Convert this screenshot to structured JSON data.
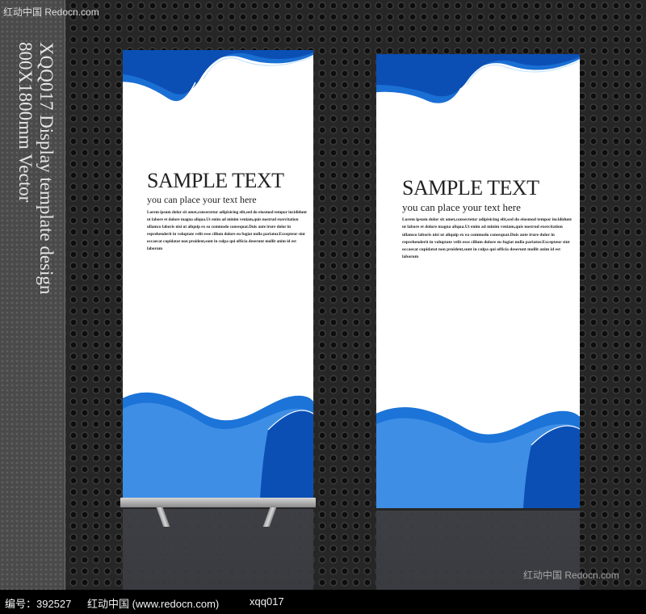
{
  "watermark_top": "红动中国 Redocn.com",
  "side_text": {
    "line1": "XQQ017 Display template design",
    "line2": "800X1800mm Vector"
  },
  "banners": [
    {
      "title": "SAMPLE TEXT",
      "subtitle": "you can place your text here",
      "lorem": "Lorem ipsum dolor sit amet,consectetur adipisicing elit,sed do eiusmod tempor incididunt ut labore et dolore magna aliqua.Ut enim ad minim veniam,quis nostrud exercitation ullamco laboris nisi ut aliquip ex ea commodo consequat.Duis aute irure dolor in reprehenderit in voluptate velit esse cillum dolore eu fugiat nulla pariatur.Excepteur sint occaecat cupidatat non proident,sunt in culpa qui officia deserunt mollit anim id est laborum"
    },
    {
      "title": "SAMPLE TEXT",
      "subtitle": "you can place your text here",
      "lorem": "Lorem ipsum dolor sit amet,consectetur adipisicing elit,sed do eiusmod tempor incididunt ut labore et dolore magna aliqua.Ut enim ad minim veniam,quis nostrud exercitation ullamco laboris nisi ut aliquip ex ea commodo consequat.Duis aute irure dolor in reprehenderit in voluptate velit esse cillum dolore eu fugiat nulla pariatur.Excepteur sint occaecat cupidatat non proident,sunt in culpa qui officia deserunt mollit anim id est laborum"
    }
  ],
  "watermark_bottom": "红动中国 Redocn.com",
  "footer": {
    "id_label": "编号：392527",
    "site": "红动中国 (www.redocn.com)",
    "code": "xqq017"
  },
  "colors": {
    "wave_dark": "#0b4fb5",
    "wave_mid": "#1c74d8",
    "wave_light": "#5fb0f0"
  }
}
